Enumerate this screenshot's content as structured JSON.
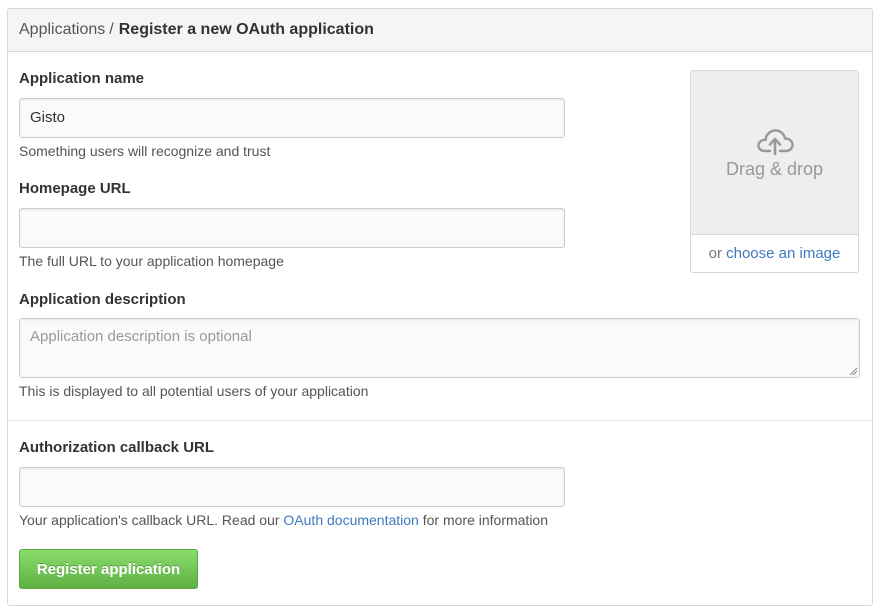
{
  "header": {
    "breadcrumb": "Applications",
    "separator": "/",
    "title": "Register a new OAuth application"
  },
  "form": {
    "app_name": {
      "label": "Application name",
      "value": "Gisto",
      "help": "Something users will recognize and trust"
    },
    "homepage": {
      "label": "Homepage URL",
      "value": "",
      "help": "The full URL to your application homepage"
    },
    "description": {
      "label": "Application description",
      "placeholder": "Application description is optional",
      "help": "This is displayed to all potential users of your application"
    },
    "callback": {
      "label": "Authorization callback URL",
      "value": "",
      "help_before": "Your application's callback URL. Read our",
      "help_link": "OAuth documentation",
      "help_after": "for more information"
    },
    "submit_label": "Register application"
  },
  "logo_upload": {
    "icon": "cloud-upload-icon",
    "drop_text": "Drag & drop",
    "or_text": "or",
    "choose_link": "choose an image"
  },
  "colors": {
    "link": "#4078c0",
    "button": "#6cc644"
  }
}
